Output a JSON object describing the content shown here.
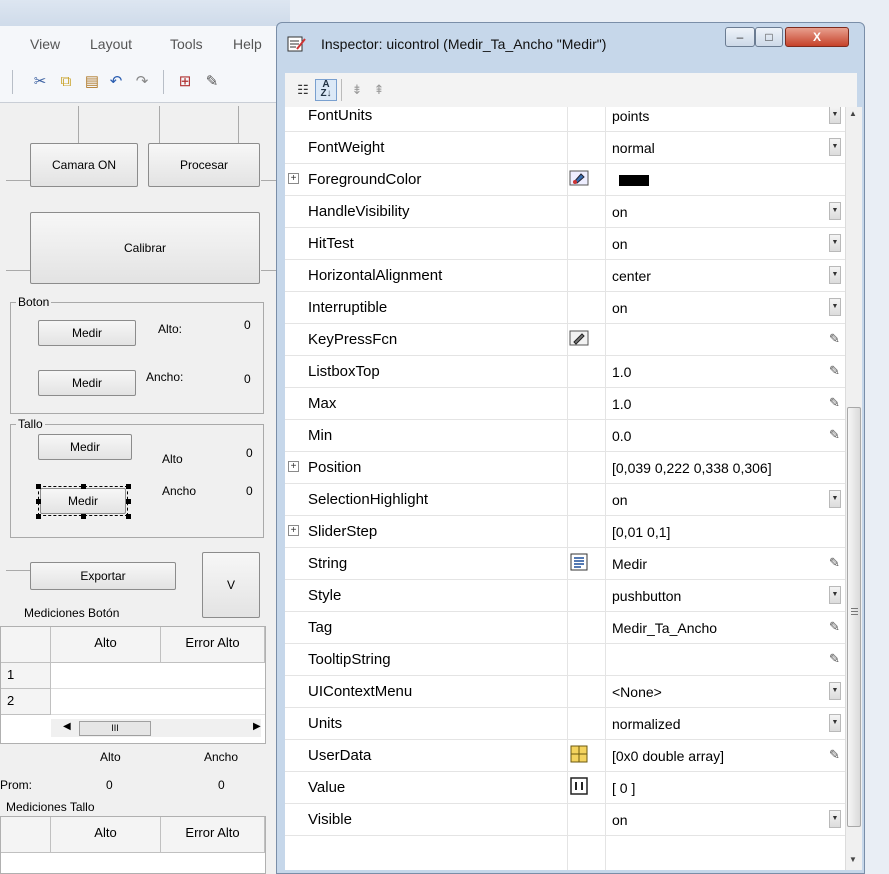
{
  "guide": {
    "menu": [
      "View",
      "Layout",
      "Tools",
      "Help"
    ],
    "toolbar_icons": [
      "cut-icon",
      "copy-icon",
      "paste-icon",
      "undo-icon",
      "redo-icon",
      "align-icon",
      "editor-icon"
    ],
    "buttons": {
      "camara": "Camara ON",
      "procesar": "Procesar",
      "calibrar": "Calibrar",
      "exportar": "Exportar",
      "v": "V"
    },
    "boton_panel": {
      "title": "Boton",
      "medir1": "Medir",
      "medir2": "Medir",
      "alto_label": "Alto:",
      "alto_value": "0",
      "ancho_label": "Ancho:",
      "ancho_value": "0"
    },
    "tallo_panel": {
      "title": "Tallo",
      "medir1": "Medir",
      "medir2": "Medir",
      "alto_label": "Alto",
      "alto_value": "0",
      "ancho_label": "Ancho",
      "ancho_value": "0"
    },
    "mediciones_boton": {
      "label": "Mediciones Botón",
      "headers": [
        "Alto",
        "Error Alto"
      ],
      "rows": [
        "1",
        "2"
      ],
      "scroll_mark": "III"
    },
    "prom": {
      "label": "Prom:",
      "alto_header": "Alto",
      "ancho_header": "Ancho",
      "alto_value": "0",
      "ancho_value": "0"
    },
    "mediciones_tallo": {
      "label": "Mediciones Tallo",
      "headers": [
        "Alto",
        "Error Alto"
      ]
    }
  },
  "inspector": {
    "title": "Inspector:  uicontrol (Medir_Ta_Ancho \"Medir\")",
    "window_buttons": {
      "minimize": "–",
      "maximize": "□",
      "close": "X"
    },
    "toolbar_icons": [
      "categorized-icon",
      "sort-az-icon",
      "expand-all-icon",
      "collapse-all-icon"
    ],
    "properties": [
      {
        "name": "FontUnits",
        "value": "points",
        "control": "drop"
      },
      {
        "name": "FontWeight",
        "value": "normal",
        "control": "drop"
      },
      {
        "name": "ForegroundColor",
        "value": "",
        "expand": "+",
        "icon": "color-picker-icon",
        "swatch": "#000000"
      },
      {
        "name": "HandleVisibility",
        "value": "on",
        "control": "drop"
      },
      {
        "name": "HitTest",
        "value": "on",
        "control": "drop"
      },
      {
        "name": "HorizontalAlignment",
        "value": "center",
        "control": "drop"
      },
      {
        "name": "Interruptible",
        "value": "on",
        "control": "drop"
      },
      {
        "name": "KeyPressFcn",
        "value": "",
        "icon": "callback-icon",
        "control": "edit"
      },
      {
        "name": "ListboxTop",
        "value": "1.0",
        "control": "edit"
      },
      {
        "name": "Max",
        "value": "1.0",
        "control": "edit"
      },
      {
        "name": "Min",
        "value": "0.0",
        "control": "edit"
      },
      {
        "name": "Position",
        "value": "[0,039 0,222 0,338 0,306]",
        "expand": "+"
      },
      {
        "name": "SelectionHighlight",
        "value": "on",
        "control": "drop"
      },
      {
        "name": "SliderStep",
        "value": "[0,01 0,1]",
        "expand": "+"
      },
      {
        "name": "String",
        "value": "Medir",
        "icon": "text-icon",
        "control": "edit"
      },
      {
        "name": "Style",
        "value": "pushbutton",
        "control": "drop"
      },
      {
        "name": "Tag",
        "value": "Medir_Ta_Ancho",
        "control": "edit"
      },
      {
        "name": "TooltipString",
        "value": "",
        "control": "edit"
      },
      {
        "name": "UIContextMenu",
        "value": "<None>",
        "control": "drop"
      },
      {
        "name": "Units",
        "value": "normalized",
        "control": "drop"
      },
      {
        "name": "UserData",
        "value": "[0x0  double array]",
        "icon": "grid-icon",
        "control": "edit"
      },
      {
        "name": "Value",
        "value": "[ 0 ]",
        "icon": "array-icon"
      },
      {
        "name": "Visible",
        "value": "on",
        "control": "drop"
      }
    ]
  }
}
